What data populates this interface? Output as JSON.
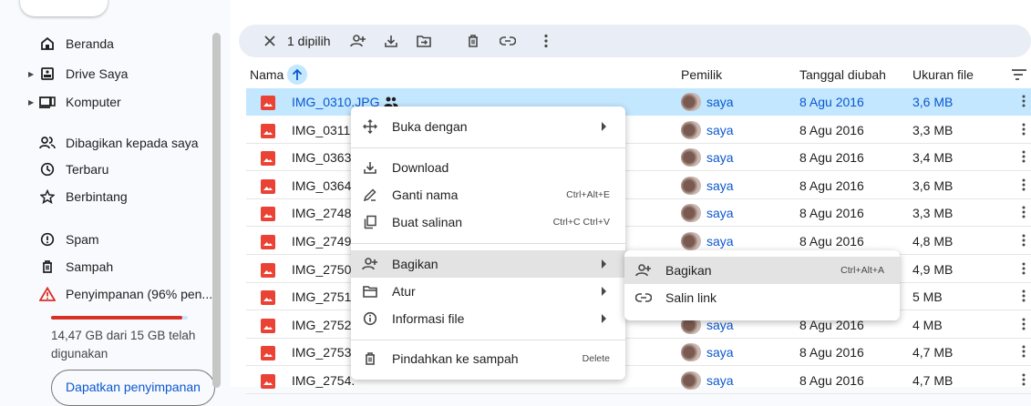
{
  "sidebar": {
    "items": [
      {
        "label": "Beranda",
        "icon": "home-icon"
      },
      {
        "label": "Drive Saya",
        "icon": "drive-icon"
      },
      {
        "label": "Komputer",
        "icon": "computer-icon"
      },
      {
        "label": "Dibagikan kepada saya",
        "icon": "shared-icon"
      },
      {
        "label": "Terbaru",
        "icon": "clock-icon"
      },
      {
        "label": "Berbintang",
        "icon": "star-icon"
      },
      {
        "label": "Spam",
        "icon": "spam-icon"
      },
      {
        "label": "Sampah",
        "icon": "trash-icon"
      },
      {
        "label": "Penyimpanan (96% pen...",
        "icon": "warning-icon"
      }
    ],
    "storage_percent": 96,
    "storage_text": "14,47 GB dari 15 GB telah digunakan",
    "get_storage_label": "Dapatkan penyimpanan"
  },
  "selection_bar": {
    "count_label": "1 dipilih",
    "actions": [
      "close-icon",
      "share-icon",
      "download-icon",
      "move-icon",
      "trash-icon",
      "link-icon",
      "more-icon"
    ]
  },
  "table": {
    "headers": {
      "name": "Nama",
      "owner": "Pemilik",
      "modified": "Tanggal diubah",
      "size": "Ukuran file"
    },
    "rows": [
      {
        "name": "IMG_0310.JPG",
        "owner": "saya",
        "date": "8 Agu 2016",
        "size": "3,6 MB",
        "selected": true
      },
      {
        "name": "IMG_0311.",
        "owner": "saya",
        "date": "8 Agu 2016",
        "size": "3,3 MB"
      },
      {
        "name": "IMG_0363",
        "owner": "saya",
        "date": "8 Agu 2016",
        "size": "3,4 MB"
      },
      {
        "name": "IMG_0364",
        "owner": "saya",
        "date": "8 Agu 2016",
        "size": "3,6 MB"
      },
      {
        "name": "IMG_2748.",
        "owner": "saya",
        "date": "8 Agu 2016",
        "size": "3,3 MB"
      },
      {
        "name": "IMG_2749.",
        "owner": "saya",
        "date": "8 Agu 2016",
        "size": "4,8 MB"
      },
      {
        "name": "IMG_2750",
        "owner": "",
        "date": "",
        "size": "4,9 MB"
      },
      {
        "name": "IMG_2751.",
        "owner": "",
        "date": "",
        "size": "5 MB"
      },
      {
        "name": "IMG_2752.",
        "owner": "saya",
        "date": "8 Agu 2016",
        "size": "4 MB"
      },
      {
        "name": "IMG_2753.",
        "owner": "saya",
        "date": "8 Agu 2016",
        "size": "4,7 MB"
      },
      {
        "name": "IMG_2754.",
        "owner": "saya",
        "date": "8 Agu 2016",
        "size": "4,7 MB"
      }
    ]
  },
  "context_menu": {
    "open_with": "Buka dengan",
    "download": "Download",
    "rename": "Ganti nama",
    "rename_shortcut": "Ctrl+Alt+E",
    "copy": "Buat salinan",
    "copy_shortcut": "Ctrl+C Ctrl+V",
    "share": "Bagikan",
    "organize": "Atur",
    "file_info": "Informasi file",
    "move_to_trash": "Pindahkan ke sampah",
    "trash_shortcut": "Delete"
  },
  "submenu": {
    "share": "Bagikan",
    "share_shortcut": "Ctrl+Alt+A",
    "copy_link": "Salin link"
  },
  "colors": {
    "accent": "#0b57d0",
    "selected_row": "#c2e7ff",
    "file_icon": "#ea4335",
    "warning": "#d93025"
  }
}
